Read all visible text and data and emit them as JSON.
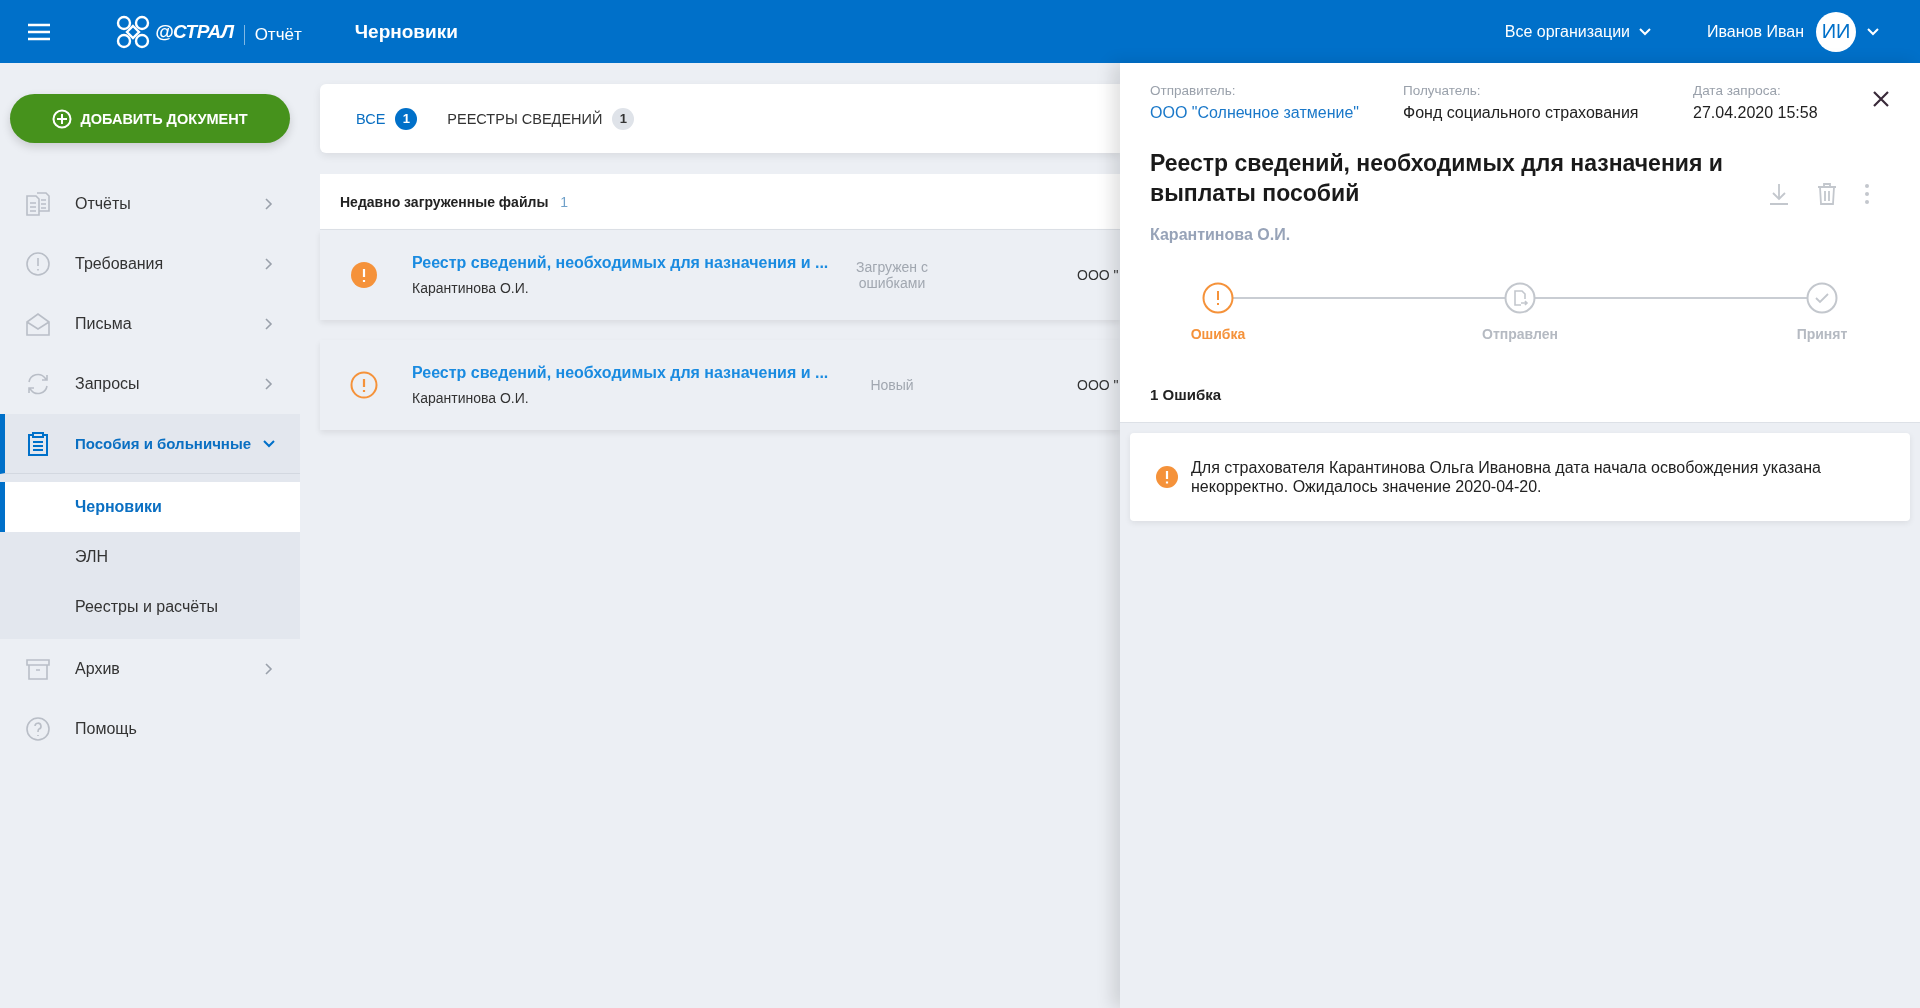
{
  "header": {
    "brand": "@СТРАЛ",
    "product": "Отчёт",
    "page_title": "Черновики",
    "org_selector": "Все организации",
    "user_name": "Иванов Иван",
    "avatar_initials": "ИИ"
  },
  "sidebar": {
    "add_button": "ДОБАВИТЬ ДОКУМЕНТ",
    "items": [
      {
        "label": "Отчёты",
        "expanded": false,
        "selected": false
      },
      {
        "label": "Требования",
        "expanded": false,
        "selected": false
      },
      {
        "label": "Письма",
        "expanded": false,
        "selected": false
      },
      {
        "label": "Запросы",
        "expanded": false,
        "selected": false
      },
      {
        "label": "Пособия и больничные",
        "expanded": true,
        "selected": true,
        "children": [
          {
            "label": "Черновики",
            "selected": true
          },
          {
            "label": "ЭЛН",
            "selected": false
          },
          {
            "label": "Реестры и расчёты",
            "selected": false
          }
        ]
      },
      {
        "label": "Архив",
        "expanded": false,
        "selected": false
      },
      {
        "label": "Помощь",
        "selected": false
      }
    ]
  },
  "tabs": [
    {
      "label": "ВСЕ",
      "count": "1",
      "selected": true
    },
    {
      "label": "РЕЕСТРЫ СВЕДЕНИЙ",
      "count": "1",
      "selected": false
    }
  ],
  "recent": {
    "title": "Недавно загруженные файлы",
    "count": "1",
    "rows": [
      {
        "kind": "error",
        "title": "Реестр сведений, необходимых для назначения и ...",
        "author": "Карантинова О.И.",
        "status": "Загружен с ошибками",
        "column_3": "ООО \""
      },
      {
        "kind": "new",
        "title": "Реестр сведений, необходимых для назначения и ...",
        "author": "Карантинова О.И.",
        "status": "Новый",
        "column_3": "ООО \""
      }
    ]
  },
  "detail": {
    "meta": [
      {
        "label": "Отправитель:",
        "value": "ООО \"Солнечное затмение\"",
        "kind": "link"
      },
      {
        "label": "Получатель:",
        "value": "Фонд социального страхования",
        "kind": "text"
      },
      {
        "label": "Дата запроса:",
        "value": "27.04.2020 15:58",
        "kind": "text"
      }
    ],
    "title": "Реестр сведений, необходимых для назначения и выплаты пособий",
    "author": "Карантинова О.И.",
    "steps": [
      {
        "label": "Ошибка",
        "kind": "error"
      },
      {
        "label": "Отправлен",
        "kind": "pending"
      },
      {
        "label": "Принят",
        "kind": "pending"
      }
    ],
    "errors_title": "1 Ошибка",
    "errors": [
      "Для страхователя Карантинова Ольга Ивановна дата начала освобождения указана некорректно. Ожидалось значение 2020-04-20."
    ]
  }
}
